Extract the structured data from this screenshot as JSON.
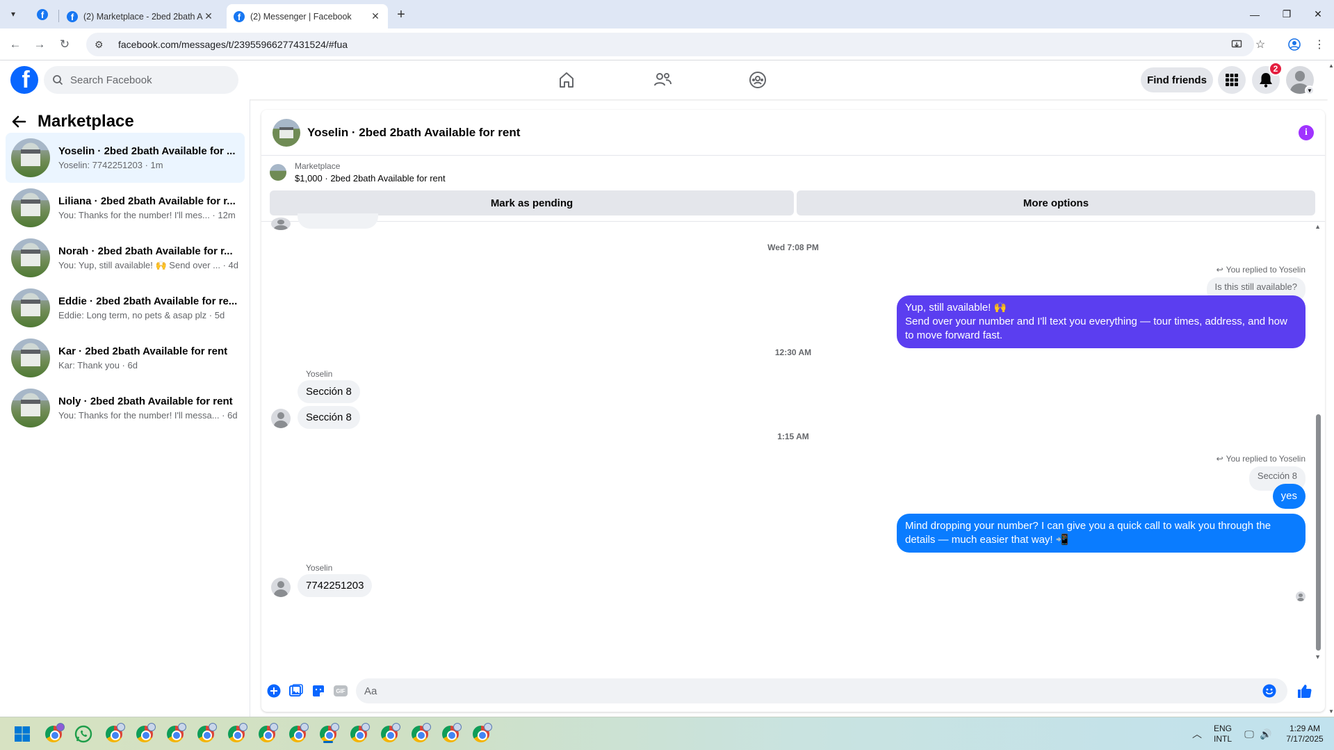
{
  "browser": {
    "tabs": [
      {
        "title": "(2) Marketplace - 2bed 2bath A",
        "active": false
      },
      {
        "title": "(2) Messenger | Facebook",
        "active": true
      }
    ],
    "url": "facebook.com/messages/t/23955966277431524/#fua"
  },
  "fb_header": {
    "search_placeholder": "Search Facebook",
    "find_friends_label": "Find friends",
    "notification_count": "2"
  },
  "sidebar": {
    "title": "Marketplace",
    "conversations": [
      {
        "name": "Yoselin · 2bed 2bath Available for ...",
        "preview": "Yoselin: 7742251203 · 1m",
        "active": true
      },
      {
        "name": "Liliana · 2bed 2bath Available for r...",
        "preview": "You: Thanks for the number! I'll mes... · 12m",
        "active": false
      },
      {
        "name": "Norah · 2bed 2bath Available for r...",
        "preview": "You: Yup, still available! 🙌 Send over ... · 4d",
        "active": false
      },
      {
        "name": "Eddie · 2bed 2bath Available for re...",
        "preview": "Eddie: Long term, no pets & asap plz · 5d",
        "active": false
      },
      {
        "name": "Kar · 2bed 2bath Available for rent",
        "preview": "Kar: Thank you · 6d",
        "active": false
      },
      {
        "name": "Noly · 2bed 2bath Available for rent",
        "preview": "You: Thanks for the number! I'll messa... · 6d",
        "active": false
      }
    ]
  },
  "chat": {
    "title": "Yoselin · 2bed 2bath Available for rent",
    "listing": {
      "source": "Marketplace",
      "summary": "$1,000 · 2bed 2bath Available for rent"
    },
    "actions": {
      "mark_pending": "Mark as pending",
      "more_options": "More options"
    },
    "timestamps": [
      "Wed 7:08 PM",
      "12:30 AM",
      "1:15 AM"
    ],
    "messages": {
      "reply_note_1": "You replied to Yoselin",
      "quote_1": "Is this still available?",
      "out_1_line1": "Yup, still available! 🙌",
      "out_1_line2": "Send over your number and I'll text you everything — tour times, address, and how",
      "out_1_line3": "to move forward fast.",
      "sender_1": "Yoselin",
      "in_1": "Sección 8",
      "in_2": "Sección 8",
      "reply_note_2": "You replied to Yoselin",
      "quote_2": "Sección 8",
      "out_2": "yes",
      "out_3_line1": "Mind dropping your number? I can give you a quick call to walk you through the",
      "out_3_line2": "details — much easier that way! 📲",
      "sender_2": "Yoselin",
      "in_3": "7742251203"
    },
    "composer_placeholder": "Aa"
  },
  "taskbar": {
    "lang_line1": "ENG",
    "lang_line2": "INTL",
    "time": "1:29 AM",
    "date": "7/17/2025"
  },
  "colors": {
    "fb_blue": "#0866ff",
    "outgoing_purple": "#5b3ef0",
    "outgoing_blue": "#0a7cff",
    "info_purple": "#a033ff",
    "badge_red": "#e41e3f"
  }
}
